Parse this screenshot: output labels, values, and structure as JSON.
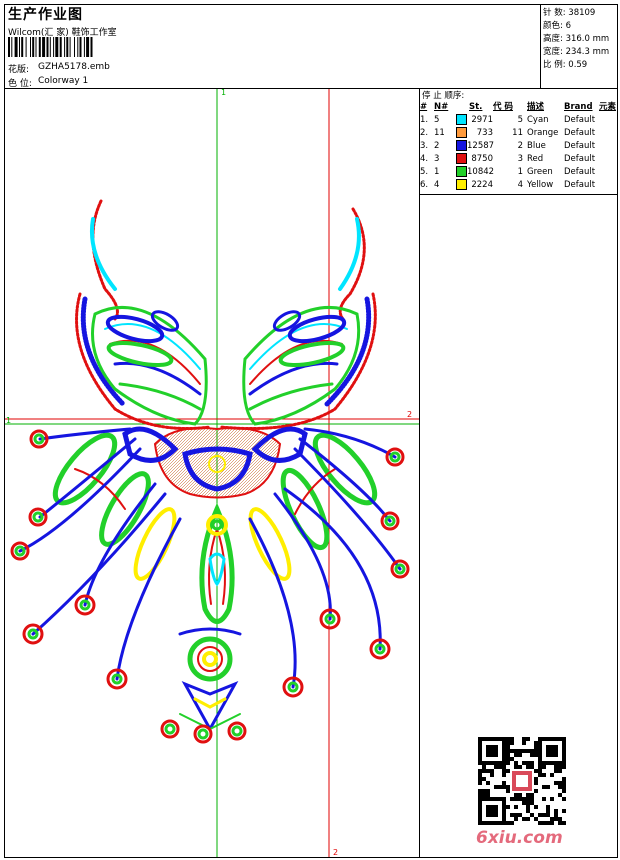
{
  "header": {
    "title": "生产作业图",
    "subtitle": "Wilcom(汇 家) 鞋饰工作室",
    "design_label": "花版:",
    "design_value": "GZHA5178.emb",
    "colorway_label": "色 位:",
    "colorway_value": "Colorway 1"
  },
  "stats": [
    {
      "label": "针 数:",
      "value": "38109"
    },
    {
      "label": "颜色:",
      "value": "6"
    },
    {
      "label": "高度:",
      "value": "316.0 mm"
    },
    {
      "label": "宽度:",
      "value": "234.3 mm"
    },
    {
      "label": "比 例:",
      "value": "0.59"
    }
  ],
  "thread_table": {
    "title": "停 止 顺序:",
    "columns": [
      "#",
      "N#",
      "St.",
      "代 码",
      "描述",
      "Brand",
      "元素"
    ],
    "rows": [
      {
        "idx": "1.",
        "n": "5",
        "color": "#00e5ff",
        "stitches": "2971",
        "code": "5",
        "desc": "Cyan",
        "brand": "Default"
      },
      {
        "idx": "2.",
        "n": "11",
        "color": "#ff9a3c",
        "stitches": "733",
        "code": "11",
        "desc": "Orange",
        "brand": "Default"
      },
      {
        "idx": "3.",
        "n": "2",
        "color": "#1515e0",
        "stitches": "12587",
        "code": "2",
        "desc": "Blue",
        "brand": "Default"
      },
      {
        "idx": "4.",
        "n": "3",
        "color": "#e01010",
        "stitches": "8750",
        "code": "3",
        "desc": "Red",
        "brand": "Default"
      },
      {
        "idx": "5.",
        "n": "1",
        "color": "#22d02a",
        "stitches": "10842",
        "code": "1",
        "desc": "Green",
        "brand": "Default"
      },
      {
        "idx": "6.",
        "n": "4",
        "color": "#ffee00",
        "stitches": "2224",
        "code": "4",
        "desc": "Yellow",
        "brand": "Default"
      }
    ]
  },
  "guides": {
    "v1": "1",
    "h1": "1",
    "h2": "2",
    "v2": "2"
  },
  "watermark": "6xiu.com"
}
